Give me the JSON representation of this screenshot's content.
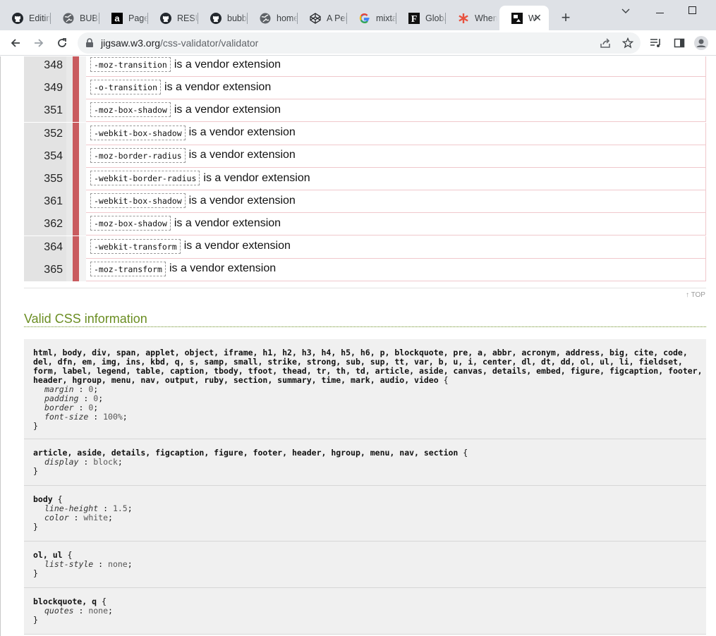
{
  "browser": {
    "tabs": [
      {
        "title": "Editing",
        "icon": "github-icon"
      },
      {
        "title": "BUBBLE",
        "icon": "globe-icon"
      },
      {
        "title": "Page",
        "icon": "amazon-icon"
      },
      {
        "title": "RESUME",
        "icon": "github-icon"
      },
      {
        "title": "bubble",
        "icon": "github-icon"
      },
      {
        "title": "home",
        "icon": "globe-icon"
      },
      {
        "title": "A Pen",
        "icon": "codepen-icon"
      },
      {
        "title": "mixtape",
        "icon": "google-icon"
      },
      {
        "title": "Global",
        "icon": "f-icon"
      },
      {
        "title": "When",
        "icon": "asterisk-icon"
      },
      {
        "title": "W",
        "icon": "w3c-icon",
        "active": true
      }
    ],
    "new_tab": "+",
    "window_controls": {
      "minimize": "—",
      "maximize": "☐",
      "close": "✕",
      "dropdown": "⌄"
    },
    "url_host": "jigsaw.w3.org",
    "url_path": "/css-validator/validator"
  },
  "errors": {
    "message_suffix": "is a vendor extension",
    "rows": [
      {
        "line": "348",
        "property": "-moz-transition"
      },
      {
        "line": "349",
        "property": "-o-transition"
      },
      {
        "line": "351",
        "property": "-moz-box-shadow"
      },
      {
        "line": "352",
        "property": "-webkit-box-shadow"
      },
      {
        "line": "354",
        "property": "-moz-border-radius"
      },
      {
        "line": "355",
        "property": "-webkit-border-radius"
      },
      {
        "line": "361",
        "property": "-webkit-box-shadow"
      },
      {
        "line": "362",
        "property": "-moz-box-shadow"
      },
      {
        "line": "364",
        "property": "-webkit-transform"
      },
      {
        "line": "365",
        "property": "-moz-transform"
      }
    ]
  },
  "top_link": "↑ TOP",
  "section_title": "Valid CSS information",
  "css_blocks": [
    {
      "selector": "html, body, div, span, applet, object, iframe, h1, h2, h3, h4, h5, h6, p, blockquote, pre, a, abbr, acronym, address, big, cite, code, del, dfn, em, img, ins, kbd, q, s, samp, small, strike, strong, sub, sup, tt, var, b, u, i, center, dl, dt, dd, ol, ul, li, fieldset, form, label, legend, table, caption, tbody, tfoot, thead, tr, th, td, article, aside, canvas, details, embed, figure, figcaption, footer, header, hgroup, menu, nav, output, ruby, section, summary, time, mark, audio, video",
      "declarations": [
        {
          "prop": "margin",
          "value": "0"
        },
        {
          "prop": "padding",
          "value": "0"
        },
        {
          "prop": "border",
          "value": "0"
        },
        {
          "prop": "font-size",
          "value": "100%"
        }
      ]
    },
    {
      "selector": "article, aside, details, figcaption, figure, footer, header, hgroup, menu, nav, section",
      "declarations": [
        {
          "prop": "display",
          "value": "block"
        }
      ]
    },
    {
      "selector": "body",
      "declarations": [
        {
          "prop": "line-height",
          "value": "1.5"
        },
        {
          "prop": "color",
          "value": "white"
        }
      ]
    },
    {
      "selector": "ol, ul",
      "declarations": [
        {
          "prop": "list-style",
          "value": "none"
        }
      ]
    },
    {
      "selector": "blockquote, q",
      "declarations": [
        {
          "prop": "quotes",
          "value": "none"
        }
      ]
    }
  ]
}
